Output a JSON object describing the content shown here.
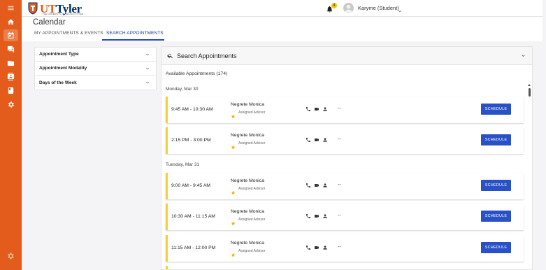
{
  "header": {
    "logo_text_ut": "UT",
    "logo_text_rest": "Tyler",
    "logo_subtitle": "THE UNIVERSITY OF TEXAS AT TYLER",
    "notification_count": "4",
    "user_name": "Karyme (Student)"
  },
  "page": {
    "title": "Calendar",
    "tabs": [
      {
        "label": "MY APPOINTMENTS & EVENTS",
        "active": false
      },
      {
        "label": "SEARCH APPOINTMENTS",
        "active": true
      }
    ]
  },
  "filters": [
    {
      "label": "Appointment Type"
    },
    {
      "label": "Appointment Modality"
    },
    {
      "label": "Days of the Week"
    }
  ],
  "search": {
    "title": "Search Appointments",
    "available_label": "Available Appointments (174)"
  },
  "days": [
    {
      "label": "Monday, Mar 30",
      "slots": [
        {
          "time": "9:45 AM - 10:30 AM",
          "advisor": "Negrete Monica",
          "role": "Assigned Advisor",
          "location": "--",
          "button": "SCHEDULE"
        },
        {
          "time": "2:15 PM - 3:00 PM",
          "advisor": "Negrete Monica",
          "role": "Assigned Advisor",
          "location": "--",
          "button": "SCHEDULE"
        }
      ]
    },
    {
      "label": "Tuesday, Mar 31",
      "slots": [
        {
          "time": "9:00 AM - 9:45 AM",
          "advisor": "Negrete Monica",
          "role": "Assigned Advisor",
          "location": "--",
          "button": "SCHEDULE"
        },
        {
          "time": "10:30 AM - 11:15 AM",
          "advisor": "Negrete Monica",
          "role": "Assigned Advisor",
          "location": "--",
          "button": "SCHEDULE"
        },
        {
          "time": "11:15 AM - 12:00 PM",
          "advisor": "Negrete Monica",
          "role": "Assigned Advisor",
          "location": "--",
          "button": "SCHEDULE"
        }
      ]
    }
  ],
  "colors": {
    "brand_orange": "#e35c1c",
    "brand_navy": "#002d6a",
    "button_blue": "#2851c7",
    "card_accent": "#f2d23b"
  },
  "rail_icons": [
    "menu-icon",
    "home-icon",
    "calendar-icon",
    "chat-icon",
    "folder-icon",
    "contacts-icon",
    "book-icon",
    "settings-icon"
  ]
}
